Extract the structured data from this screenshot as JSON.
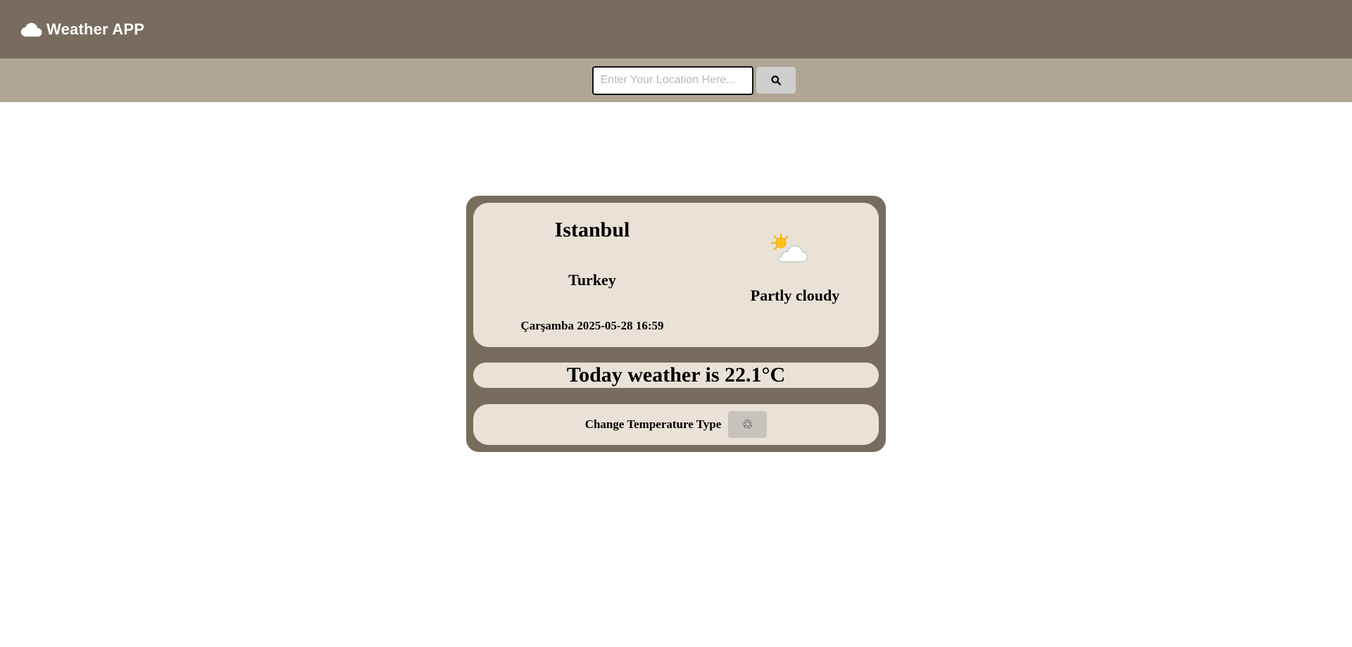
{
  "app": {
    "title": "Weather APP",
    "logo_icon": "cloud-icon"
  },
  "search": {
    "placeholder": "Enter Your Location Here...",
    "value": "",
    "button_icon": "search-icon"
  },
  "weather": {
    "city": "Istanbul",
    "country": "Turkey",
    "datetime": "Çarşamba 2025-05-28 16:59",
    "condition": "Partly cloudy",
    "condition_icon": "partly-cloudy-icon",
    "temperature_text": "Today weather is 22.1°C"
  },
  "controls": {
    "change_label": "Change Temperature Type",
    "change_button_glyph": "♲",
    "change_button_icon": "recycle-icon"
  },
  "colors": {
    "navbar": "#786c5e",
    "searchbar": "#afa696",
    "card": "#786c5e",
    "panel": "#eae2d7",
    "button": "#cfcfcf"
  }
}
